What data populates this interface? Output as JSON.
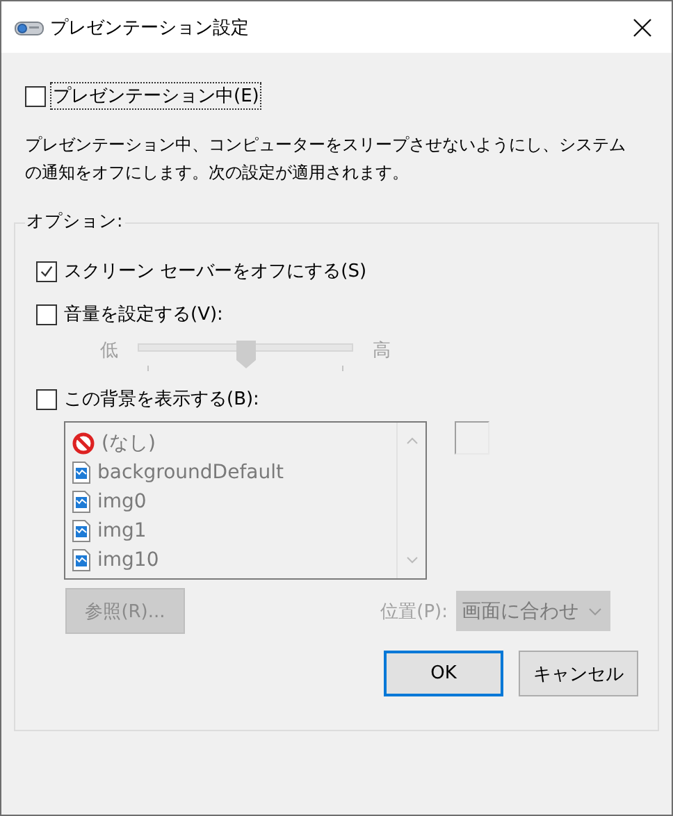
{
  "window": {
    "title": "プレゼンテーション設定"
  },
  "presenting": {
    "label": "プレゼンテーション中(E)",
    "checked": false,
    "focused": true
  },
  "description": "プレゼンテーション中、コンピューターをスリープさせないようにし、システムの通知をオフにします。次の設定が適用されます。",
  "options": {
    "legend": "オプション:",
    "screensaver": {
      "label": "スクリーン セーバーをオフにする(S)",
      "checked": true
    },
    "volume": {
      "label": "音量を設定する(V):",
      "checked": false,
      "slider": {
        "low": "低",
        "high": "高",
        "level": 0.5,
        "disabled": true
      }
    },
    "background": {
      "label": "この背景を表示する(B):",
      "checked": false,
      "list": {
        "disabled": true,
        "items": [
          {
            "label": "(なし)",
            "kind": "none"
          },
          {
            "label": "backgroundDefault",
            "kind": "image"
          },
          {
            "label": "img0",
            "kind": "image"
          },
          {
            "label": "img1",
            "kind": "image"
          },
          {
            "label": "img10",
            "kind": "image"
          }
        ]
      },
      "browse": {
        "label": "参照(R)...",
        "disabled": true
      },
      "position": {
        "label": "位置(P):",
        "value": "画面に合わせ",
        "disabled": true
      }
    }
  },
  "buttons": [
    {
      "label": "OK",
      "default": true
    },
    {
      "label": "キャンセル",
      "default": false
    }
  ]
}
